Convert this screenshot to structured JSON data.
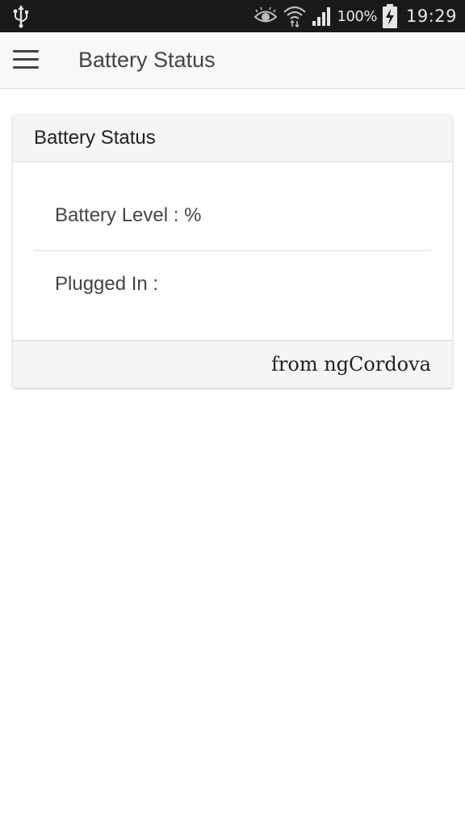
{
  "status_bar": {
    "battery_percent": "100%",
    "time": "19:29",
    "icons": [
      "usb-icon",
      "eye-icon",
      "wifi-icon",
      "signal-icon",
      "battery-charging-icon"
    ]
  },
  "app_bar": {
    "title": "Battery Status",
    "menu_icon": "hamburger-menu-icon"
  },
  "card": {
    "header": "Battery Status",
    "battery_level_label": "Battery Level : %",
    "plugged_in_label": "Plugged In :",
    "footer": "from ngCordova"
  },
  "colors": {
    "status_bar_bg": "#1a1a1a",
    "app_bar_bg": "#f8f8f8",
    "card_header_bg": "#f5f5f5",
    "text_dark": "#444444"
  }
}
